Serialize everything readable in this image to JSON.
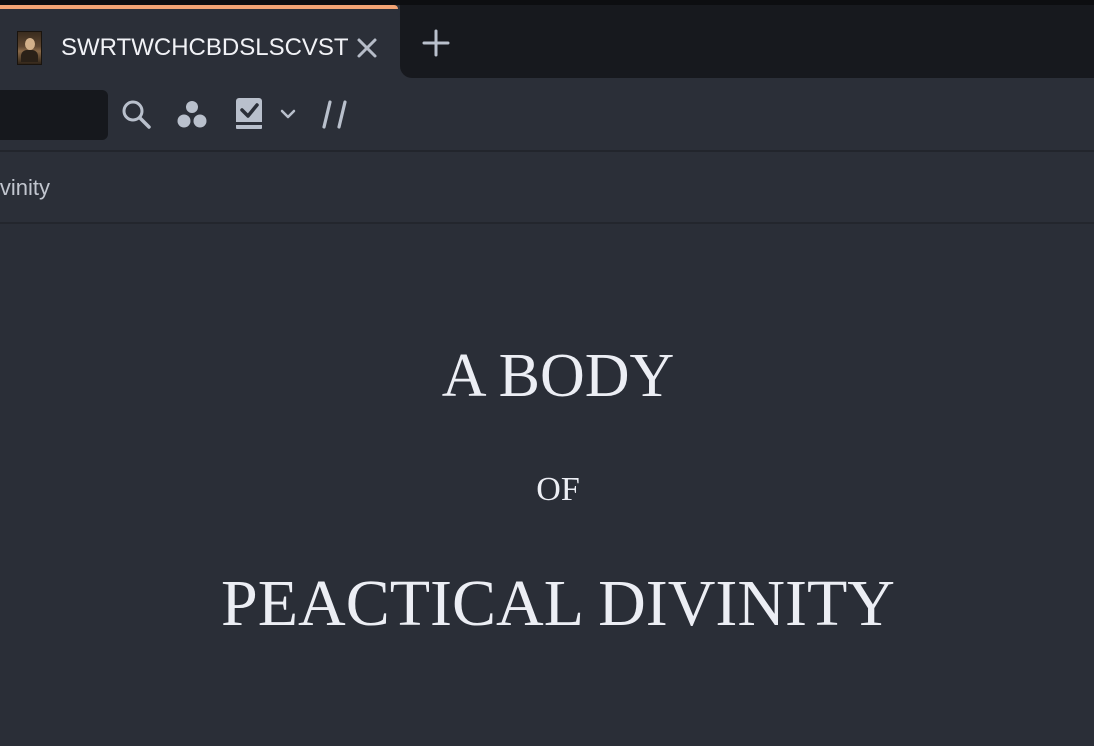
{
  "tab": {
    "title": "SWRTWCHCBDSLSCVST",
    "favicon": "portrait-thumbnail-icon",
    "close_icon": "close-icon",
    "accent_color": "#f2a374"
  },
  "new_tab_icon": "plus-icon",
  "toolbar": {
    "address_value": "",
    "search_icon": "search-icon",
    "collection_icon": "three-dots-cluster-icon",
    "bookmark_icon": "book-check-icon",
    "dropdown_icon": "chevron-down-icon",
    "marker_text": "//"
  },
  "breadcrumb": {
    "text": "Divinity"
  },
  "document": {
    "line1": "A BODY",
    "line2": "OF",
    "line3": "PEACTICAL DIVINITY"
  },
  "colors": {
    "background": "#2a2e37",
    "chrome": "#2b2f38",
    "dark_strip": "#17191e",
    "text": "#eceef4",
    "icon": "#b9c0cc"
  }
}
